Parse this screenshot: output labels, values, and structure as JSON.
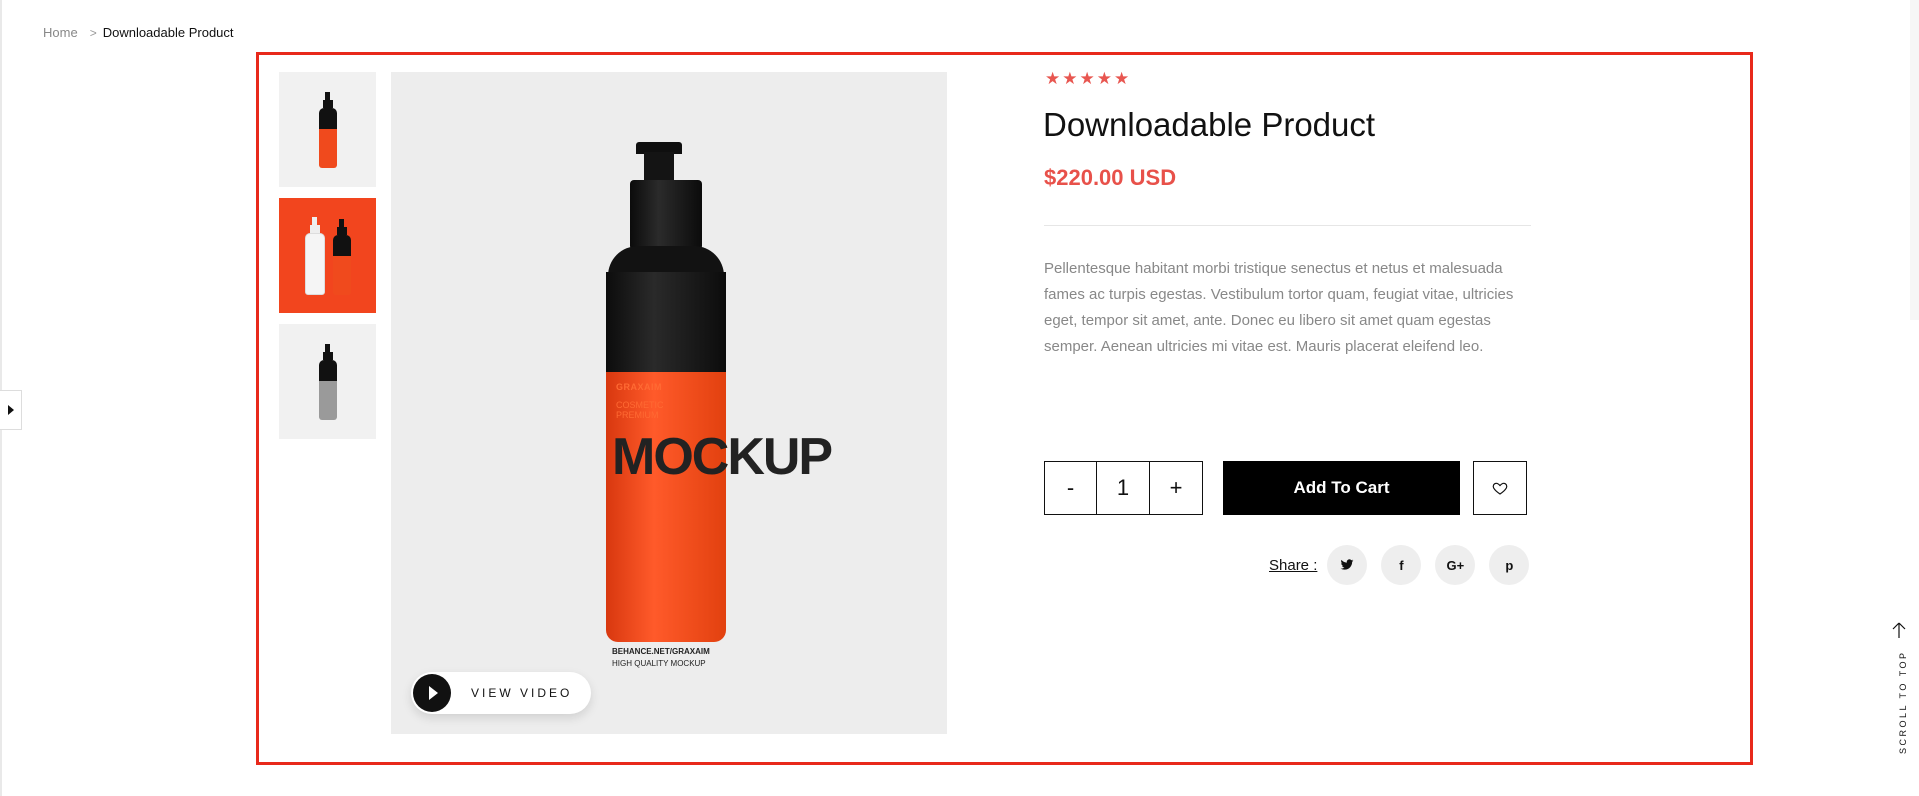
{
  "breadcrumb": {
    "home": "Home",
    "separator": ">",
    "current": "Downloadable Product"
  },
  "gallery": {
    "thumbnails": [
      {
        "name": "thumb-orange-bottle",
        "background": "#f1f1f1"
      },
      {
        "name": "thumb-two-bottles",
        "background": "#f2451e",
        "selected": true
      },
      {
        "name": "thumb-grey-bottle",
        "background": "#f1f1f1"
      }
    ],
    "bottle_label": {
      "brand": "GRAXAIM",
      "subtitle": "COSMETIC PREMIUM",
      "big_text": "MOCKUP",
      "url": "BEHANCE.NET/GRAXAIM",
      "quality": "HIGH QUALITY MOCKUP"
    },
    "video_button": {
      "label": "VIEW VIDEO",
      "icon": "play-icon"
    }
  },
  "product": {
    "rating": {
      "value": 5,
      "max": 5,
      "star_color": "#e85650"
    },
    "title": "Downloadable Product",
    "price": "$220.00 USD",
    "price_color": "#e8514a",
    "description": "Pellentesque habitant morbi tristique senectus et netus et malesuada fames ac turpis egestas. Vestibulum tortor quam, feugiat vitae, ultricies eget, tempor sit amet, ante. Donec eu libero sit amet quam egestas semper. Aenean ultricies mi vitae est. Mauris placerat eleifend leo."
  },
  "quantity": {
    "minus": "-",
    "value": "1",
    "plus": "+"
  },
  "actions": {
    "add_to_cart": "Add To Cart",
    "wishlist_icon": "heart-icon"
  },
  "share": {
    "label": "Share :",
    "networks": [
      {
        "name": "twitter",
        "glyph": "𝕥"
      },
      {
        "name": "facebook",
        "glyph": "f"
      },
      {
        "name": "google-plus",
        "glyph": "G+"
      },
      {
        "name": "pinterest",
        "glyph": "p"
      }
    ]
  },
  "scroll_to_top": {
    "label": "SCROLL TO TOP",
    "icon": "arrow-up-icon"
  },
  "highlight_color": "#e8291b"
}
